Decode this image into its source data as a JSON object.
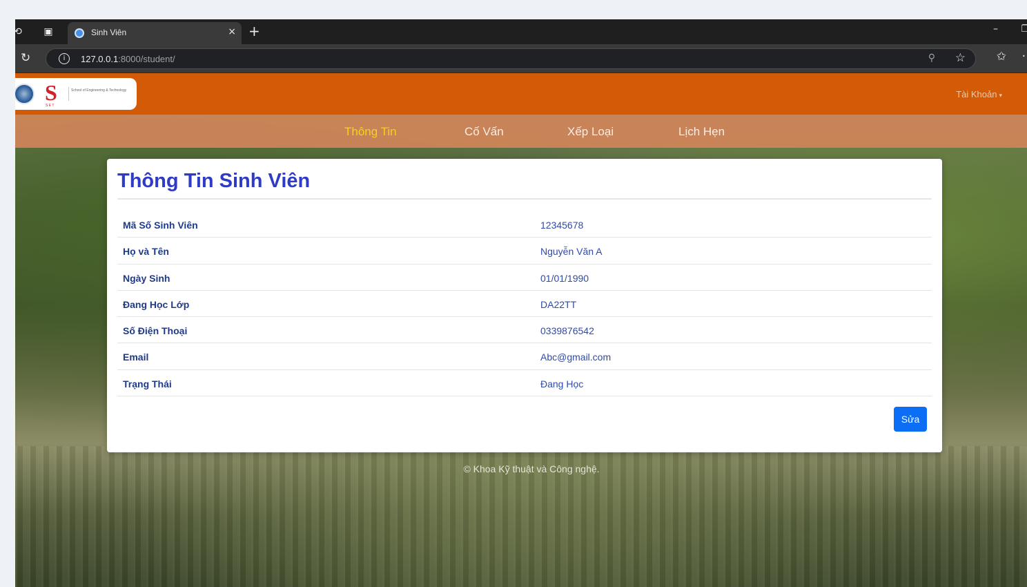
{
  "browser": {
    "tab_title": "Sinh Viên",
    "url_host": "127.0.0.1",
    "url_rest": ":8000/student/"
  },
  "site": {
    "logo_text": "School of Engineering & Technology",
    "account_label": "Tài Khoản",
    "nav": [
      {
        "label": "Thông Tin",
        "active": true
      },
      {
        "label": "Cố Vấn",
        "active": false
      },
      {
        "label": "Xếp Loại",
        "active": false
      },
      {
        "label": "Lịch Hẹn",
        "active": false
      }
    ]
  },
  "card": {
    "title": "Thông Tin Sinh Viên",
    "rows": [
      {
        "label": "Mã Số Sinh Viên",
        "value": "12345678"
      },
      {
        "label": "Họ và Tên",
        "value": "Nguyễn Văn A"
      },
      {
        "label": "Ngày Sinh",
        "value": "01/01/1990"
      },
      {
        "label": "Đang Học Lớp",
        "value": "DA22TT"
      },
      {
        "label": "Số Điện Thoại",
        "value": "0339876542"
      },
      {
        "label": "Email",
        "value": "Abc@gmail.com"
      },
      {
        "label": "Trạng Thái",
        "value": "Đang Học"
      }
    ],
    "edit_label": "Sửa"
  },
  "footer": {
    "text": "© Khoa Kỹ thuật và Công nghệ."
  },
  "colors": {
    "header_orange": "#d35a07",
    "nav_bg": "#ce8458",
    "nav_active": "#f4d21d",
    "title_blue": "#2f3bc4",
    "button_blue": "#0b6ef5"
  }
}
